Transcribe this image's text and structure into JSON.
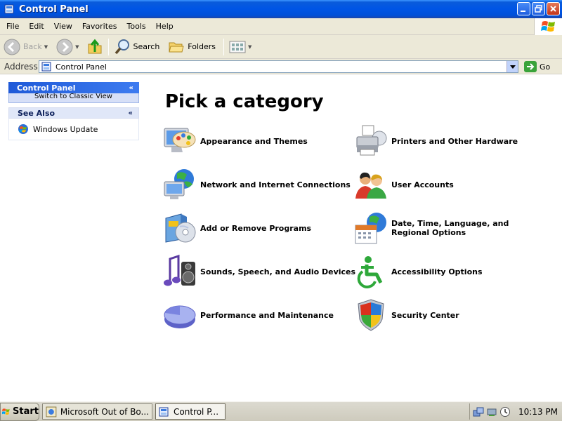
{
  "window": {
    "title": "Control Panel"
  },
  "menu": [
    "File",
    "Edit",
    "View",
    "Favorites",
    "Tools",
    "Help"
  ],
  "toolbar": {
    "back": "Back",
    "search": "Search",
    "folders": "Folders"
  },
  "address": {
    "label": "Address",
    "value": "Control Panel",
    "go": "Go"
  },
  "left_pane": {
    "control_panel": {
      "title": "Control Panel",
      "switch_link": "Switch to Classic View"
    },
    "see_also": {
      "title": "See Also",
      "windows_update": "Windows Update"
    }
  },
  "main": {
    "heading": "Pick a category",
    "categories": [
      {
        "label": "Appearance and Themes",
        "icon": "appearance-icon"
      },
      {
        "label": "Printers and Other Hardware",
        "icon": "printer-icon"
      },
      {
        "label": "Network and Internet Connections",
        "icon": "network-icon"
      },
      {
        "label": "User Accounts",
        "icon": "users-icon"
      },
      {
        "label": "Add or Remove Programs",
        "icon": "programs-icon"
      },
      {
        "label": "Date, Time, Language, and Regional Options",
        "icon": "datetime-icon"
      },
      {
        "label": "Sounds, Speech, and Audio Devices",
        "icon": "sound-icon"
      },
      {
        "label": "Accessibility Options",
        "icon": "accessibility-icon"
      },
      {
        "label": "Performance and Maintenance",
        "icon": "performance-icon"
      },
      {
        "label": "Security Center",
        "icon": "shield-icon"
      }
    ]
  },
  "taskbar": {
    "start": "Start",
    "tasks": [
      "Microsoft Out of Bo...",
      "Control P..."
    ],
    "clock": "10:13 PM"
  }
}
